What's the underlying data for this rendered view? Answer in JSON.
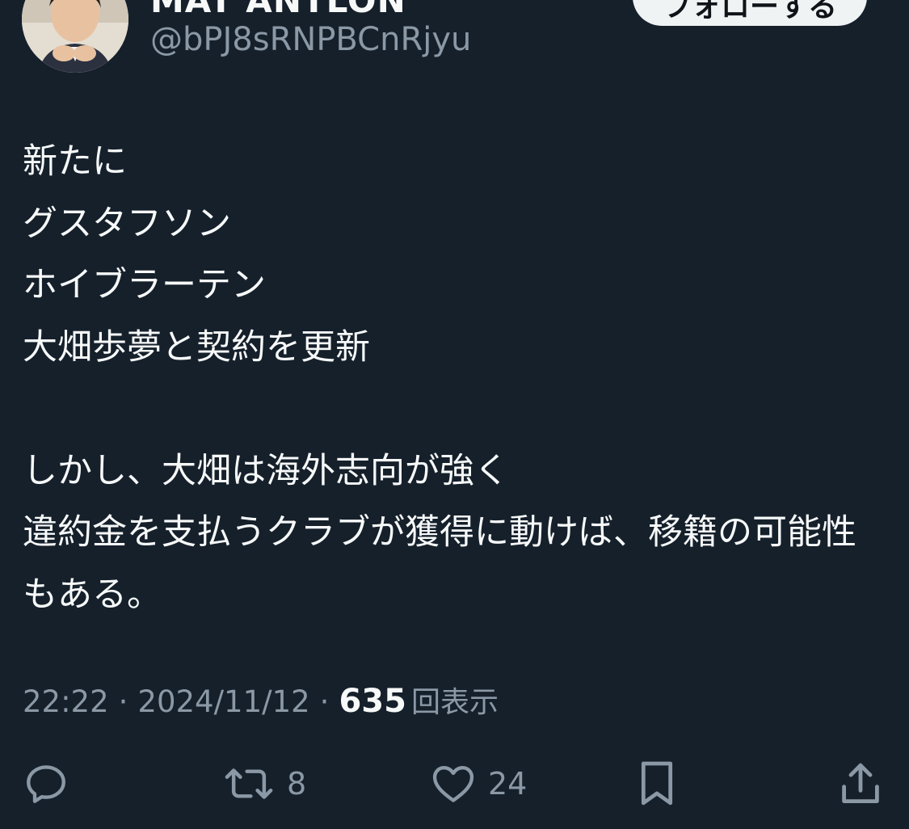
{
  "author": {
    "display_name": "MAT ANTLON",
    "handle": "@bPJ8sRNPBCnRjyu"
  },
  "follow_button": {
    "label": "フォローする"
  },
  "tweet": {
    "text": "新たに\nグスタフソン\nホイブラーテン\n大畑歩夢と契約を更新\n\nしかし、大畑は海外志向が強く\n違約金を支払うクラブが獲得に動けば、移籍の可能性もある。",
    "time": "22:22",
    "separator": "·",
    "date": "2024/11/12",
    "views_count": "635",
    "views_label": "回表示"
  },
  "actions": {
    "reply": {
      "icon": "reply-icon",
      "count": ""
    },
    "retweet": {
      "icon": "retweet-icon",
      "count": "8"
    },
    "like": {
      "icon": "heart-icon",
      "count": "24"
    },
    "bookmark": {
      "icon": "bookmark-icon",
      "count": ""
    },
    "share": {
      "icon": "share-icon",
      "count": ""
    }
  },
  "colors": {
    "background": "#15202b",
    "text_primary": "#f7f9f9",
    "text_secondary": "#8b98a5",
    "follow_button_bg": "#eff3f4"
  }
}
